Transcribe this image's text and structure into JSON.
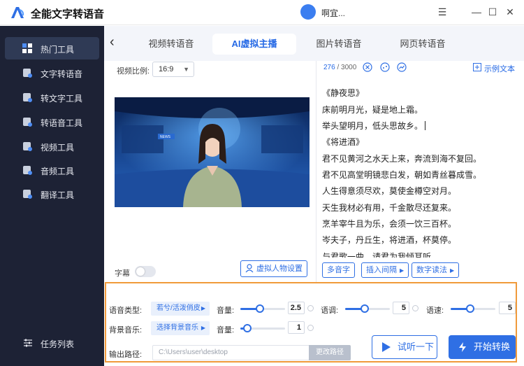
{
  "app": {
    "title": "全能文字转语音",
    "user_name": "啊宜..."
  },
  "sidebar": {
    "items": [
      {
        "label": "热门工具",
        "active": true
      },
      {
        "label": "文字转语音"
      },
      {
        "label": "转文字工具"
      },
      {
        "label": "转语音工具"
      },
      {
        "label": "视频工具"
      },
      {
        "label": "音频工具"
      },
      {
        "label": "翻译工具"
      }
    ],
    "task_list_label": "任务列表"
  },
  "tabs": [
    {
      "label": "视频转语音"
    },
    {
      "label": "AI虚拟主播",
      "active": true
    },
    {
      "label": "图片转语音"
    },
    {
      "label": "网页转语音"
    }
  ],
  "left_panel": {
    "ratio_label": "视频比例:",
    "ratio_value": "16:9",
    "subtitle_label": "字幕",
    "avatar_settings_label": "虚拟人物设置",
    "video_overlay_text": "NEWS"
  },
  "text_panel": {
    "char_count": "276",
    "char_limit": "/ 3000",
    "example_label": "示例文本",
    "lines": [
      "《静夜思》",
      "床前明月光，疑是地上霜。",
      "举头望明月，低头思故乡。",
      "《将进酒》",
      "君不见黄河之水天上来，奔流到海不复回。",
      "君不见高堂明镜悲白发，朝如青丝暮成雪。",
      "人生得意须尽欢，莫使金樽空对月。",
      "天生我材必有用，千金散尽还复来。",
      "烹羊宰牛且为乐，会须一饮三百杯。",
      "岑夫子，丹丘生，将进酒，杯莫停。",
      "与君歌一曲，请君为我倾耳听。"
    ],
    "actions": [
      "多音字",
      "插入间隔",
      "数字读法"
    ]
  },
  "settings": {
    "voice_type_label": "语音类型:",
    "voice_type_value": "若兮/活泼俏皮",
    "volume_label": "音量:",
    "volume_value": "2.5",
    "tone_label": "语调:",
    "tone_value": "5",
    "speed_label": "语速:",
    "speed_value": "5",
    "bgm_label": "背景音乐:",
    "bgm_value": "选择背景音乐",
    "bgm_volume_label": "音量:",
    "bgm_volume_value": "1",
    "path_label": "输出路径:",
    "path_value": "C:\\Users\\user\\desktop",
    "change_path_label": "更改路径",
    "listen_label": "试听一下",
    "start_label": "开始转换"
  },
  "colors": {
    "accent": "#2f6fe4",
    "sidebar_bg": "#1d2235",
    "highlight_border": "#f09a3a"
  }
}
